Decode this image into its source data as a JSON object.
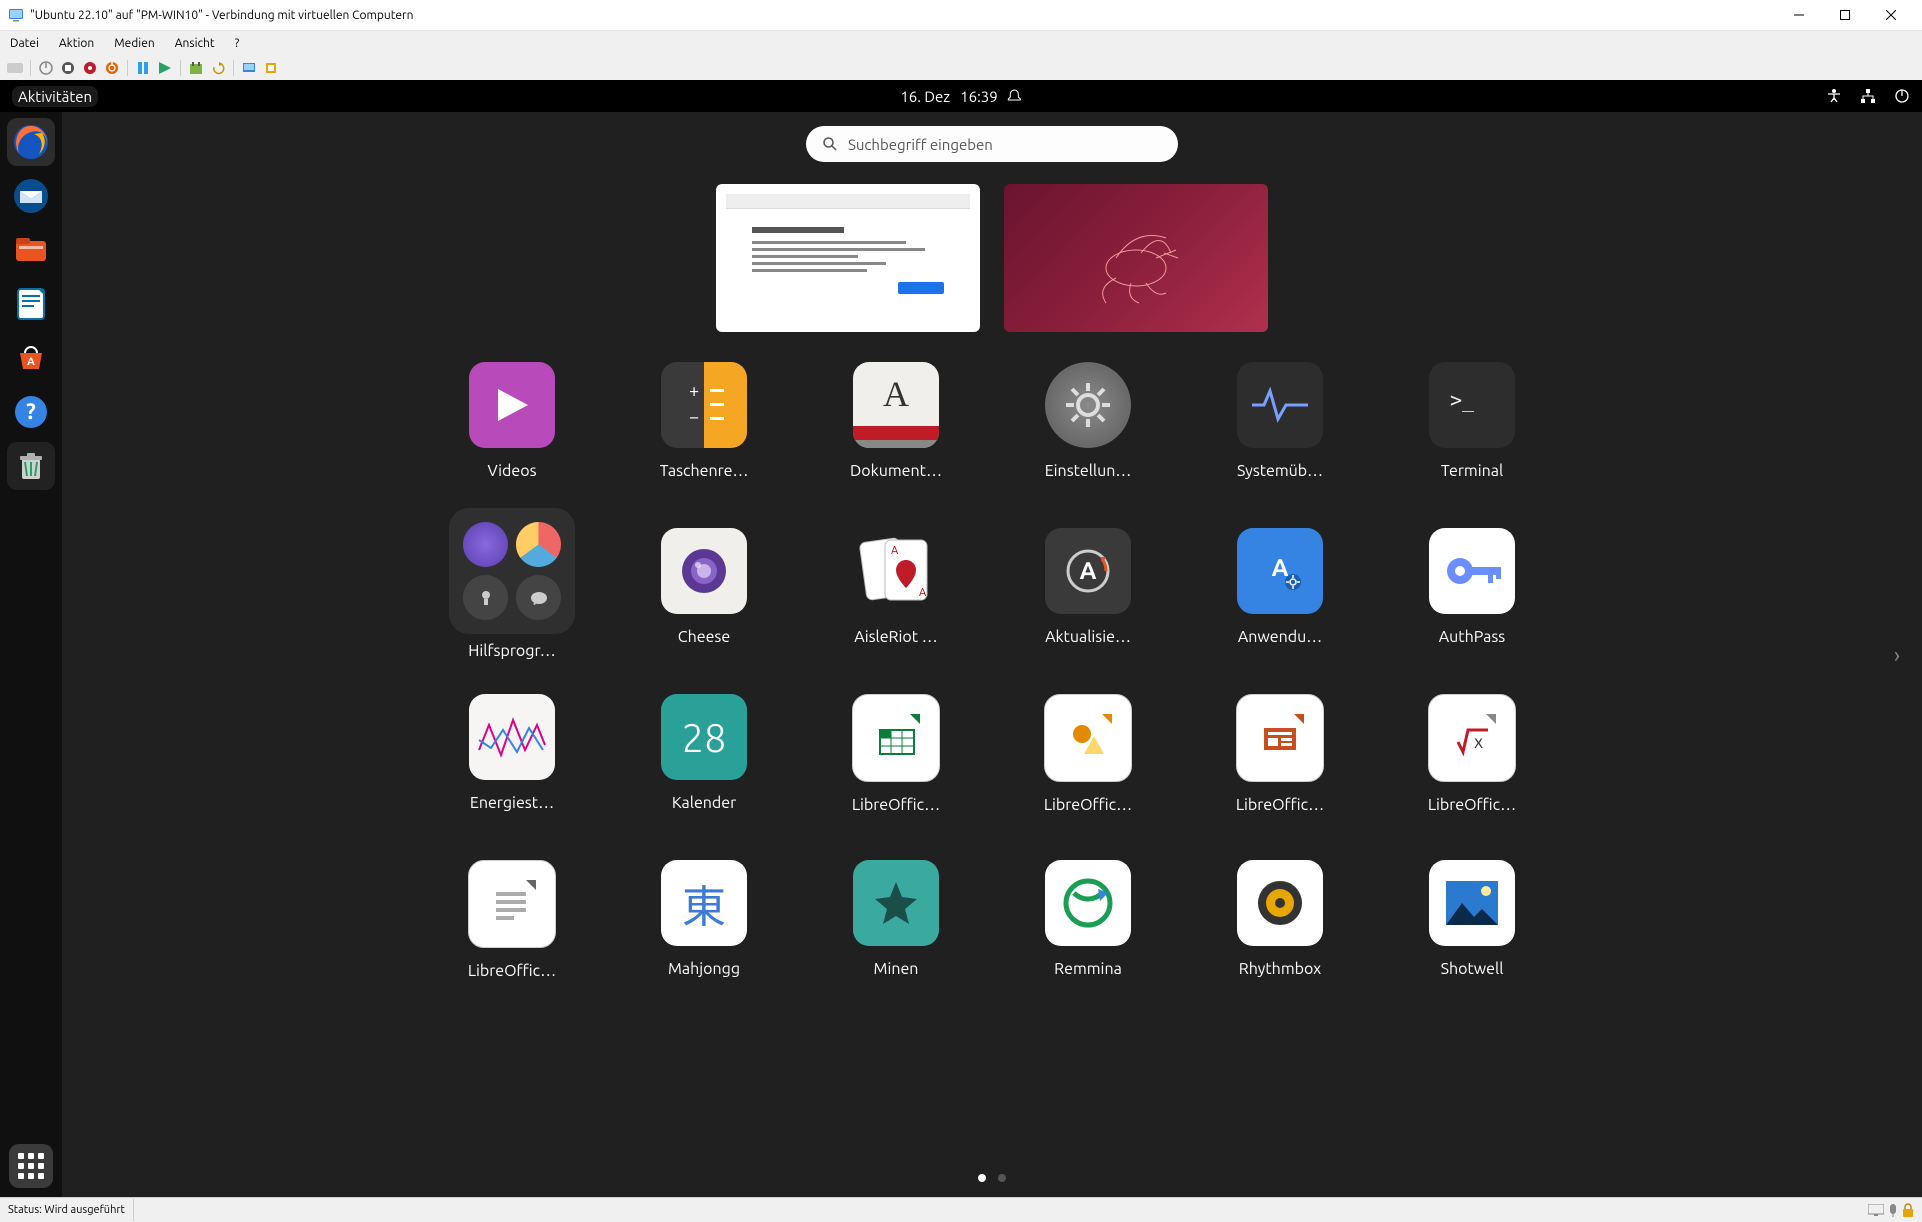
{
  "host": {
    "title": "\"Ubuntu 22.10\" auf \"PM-WIN10\" - Verbindung mit virtuellen Computern",
    "menu": [
      "Datei",
      "Aktion",
      "Medien",
      "Ansicht",
      "?"
    ],
    "status": "Status: Wird ausgeführt"
  },
  "topbar": {
    "activities": "Aktivitäten",
    "date": "16. Dez",
    "time": "16:39"
  },
  "search": {
    "placeholder": "Suchbegriff eingeben"
  },
  "dock": [
    {
      "name": "firefox",
      "color1": "#ff7139",
      "color2": "#0a84ff"
    },
    {
      "name": "thunderbird",
      "color1": "#0a4d8c",
      "color2": "#fff"
    },
    {
      "name": "files",
      "color1": "#e95420",
      "color2": "#fff"
    },
    {
      "name": "libreoffice-writer",
      "color1": "#0b6fa4",
      "color2": "#fff"
    },
    {
      "name": "ubuntu-software",
      "color1": "#e95420",
      "color2": "#fff"
    },
    {
      "name": "help",
      "color1": "#3584e4",
      "color2": "#fff"
    },
    {
      "name": "trash",
      "color1": "#6e6e6e",
      "color2": "#fff"
    }
  ],
  "apps": [
    {
      "label": "Videos",
      "bg": "#b94ab9",
      "fg": "#fff",
      "glyph": "▶"
    },
    {
      "label": "Taschenre…",
      "bg": "split",
      "fg": "#fff",
      "glyph": "calc"
    },
    {
      "label": "Dokument…",
      "bg": "#fff",
      "fg": "#c33",
      "glyph": "A"
    },
    {
      "label": "Einstellun…",
      "bg": "#6e6e6e",
      "fg": "#ddd",
      "glyph": "gear"
    },
    {
      "label": "Systemüb…",
      "bg": "#2d2d2d",
      "fg": "#7aa0ff",
      "glyph": "pulse"
    },
    {
      "label": "Terminal",
      "bg": "#2d2d2d",
      "fg": "#fff",
      "glyph": ">_"
    },
    {
      "label": "Hilfsprogr…",
      "bg": "folder",
      "fg": "",
      "glyph": "folder"
    },
    {
      "label": "Cheese",
      "bg": "#f6f5f4",
      "fg": "#6a4da3",
      "glyph": "lens"
    },
    {
      "label": "AisleRiot …",
      "bg": "#fff",
      "fg": "#c00",
      "glyph": "cards"
    },
    {
      "label": "Aktualisie…",
      "bg": "#2d2d2d",
      "fg": "#fff",
      "glyph": "updateA"
    },
    {
      "label": "Anwendu…",
      "bg": "#3584e4",
      "fg": "#fff",
      "glyph": "Agear"
    },
    {
      "label": "AuthPass",
      "bg": "#fff",
      "fg": "#6a8dff",
      "glyph": "key"
    },
    {
      "label": "Energiest…",
      "bg": "#f6f5f4",
      "fg": "#d08",
      "glyph": "wave"
    },
    {
      "label": "Kalender",
      "bg": "#2aa198",
      "fg": "#fff",
      "glyph": "28"
    },
    {
      "label": "LibreOffic…",
      "bg": "#fff",
      "fg": "#0a7e3a",
      "glyph": "calc-sheet"
    },
    {
      "label": "LibreOffic…",
      "bg": "#fff",
      "fg": "#e38b00",
      "glyph": "draw"
    },
    {
      "label": "LibreOffic…",
      "bg": "#fff",
      "fg": "#c84f1d",
      "glyph": "impress"
    },
    {
      "label": "LibreOffic…",
      "bg": "#fff",
      "fg": "#555",
      "glyph": "math"
    },
    {
      "label": "LibreOffic…",
      "bg": "#fff",
      "fg": "#555",
      "glyph": "doc"
    },
    {
      "label": "Mahjongg",
      "bg": "#fff",
      "fg": "#3b7bd6",
      "glyph": "東"
    },
    {
      "label": "Minen",
      "bg": "#3aa99f",
      "fg": "#1b4e49",
      "glyph": "mine"
    },
    {
      "label": "Remmina",
      "bg": "#fff",
      "fg": "#1a9e55",
      "glyph": "rem"
    },
    {
      "label": "Rhythmbox",
      "bg": "#fff",
      "fg": "#e6a700",
      "glyph": "speaker"
    },
    {
      "label": "Shotwell",
      "bg": "#fff",
      "fg": "#2a7bd0",
      "glyph": "photo"
    }
  ],
  "page": {
    "current": 1,
    "total": 2
  }
}
